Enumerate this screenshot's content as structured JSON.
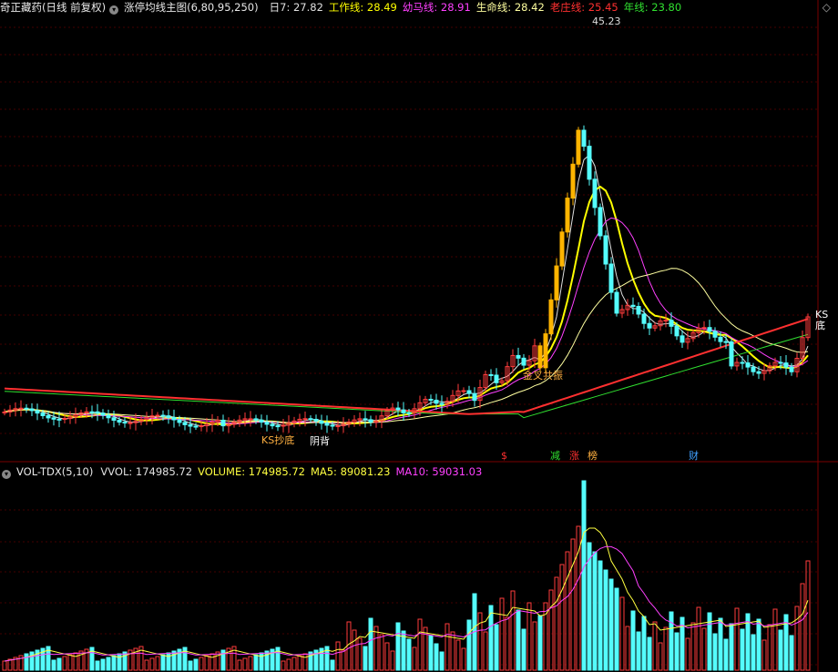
{
  "header": {
    "stock": "奇正藏药(日线 前复权)",
    "indicator": "涨停均线主图(6,80,95,250)",
    "items": [
      {
        "label": "日7: 27.82",
        "color": "#e0e0e0"
      },
      {
        "label": "工作线: 28.49",
        "color": "#ffff00"
      },
      {
        "label": "幼马线: 28.91",
        "color": "#ff40ff"
      },
      {
        "label": "生命线: 28.42",
        "color": "#ffffa0"
      },
      {
        "label": "老庄线: 25.45",
        "color": "#ff3030"
      },
      {
        "label": "年线: 23.80",
        "color": "#30e030"
      }
    ]
  },
  "vol_header": {
    "indicator": "VOL-TDX(5,10)",
    "items": [
      {
        "label": "VVOL: 174985.72",
        "color": "#e0e0e0"
      },
      {
        "label": "VOLUME: 174985.72",
        "color": "#ffff40"
      },
      {
        "label": "MA5: 89081.23",
        "color": "#ffff40"
      },
      {
        "label": "MA10: 59031.03",
        "color": "#ff40ff"
      }
    ]
  },
  "annotations": {
    "max_price": "45.23",
    "signal_cross": "金叉共振",
    "signal_bottom_left": "KS抄底",
    "signal_bottom_left2": "阴背",
    "signal_bottom_right": "KS底",
    "marker_s": "$",
    "marker_jian": "减",
    "marker_zhang": "涨",
    "marker_bang": "榜",
    "marker_cai": "财"
  },
  "colors": {
    "up": "#ff3c3c",
    "down": "#54fcfc",
    "limit": "#ffb400"
  },
  "chart_data": [
    {
      "type": "candlestick",
      "title": "奇正藏药(日线 前复权)",
      "max_label": 45.23,
      "series_names": [
        "日7",
        "工作线",
        "幼马线",
        "生命线",
        "老庄线",
        "年线"
      ],
      "last_values": [
        27.82,
        28.49,
        28.91,
        28.42,
        25.45,
        23.8
      ]
    },
    {
      "type": "bar",
      "title": "VOL-TDX(5,10)",
      "series_names": [
        "VOLUME",
        "MA5",
        "MA10"
      ],
      "last_values": [
        174985.72,
        89081.23,
        59031.03
      ]
    }
  ]
}
